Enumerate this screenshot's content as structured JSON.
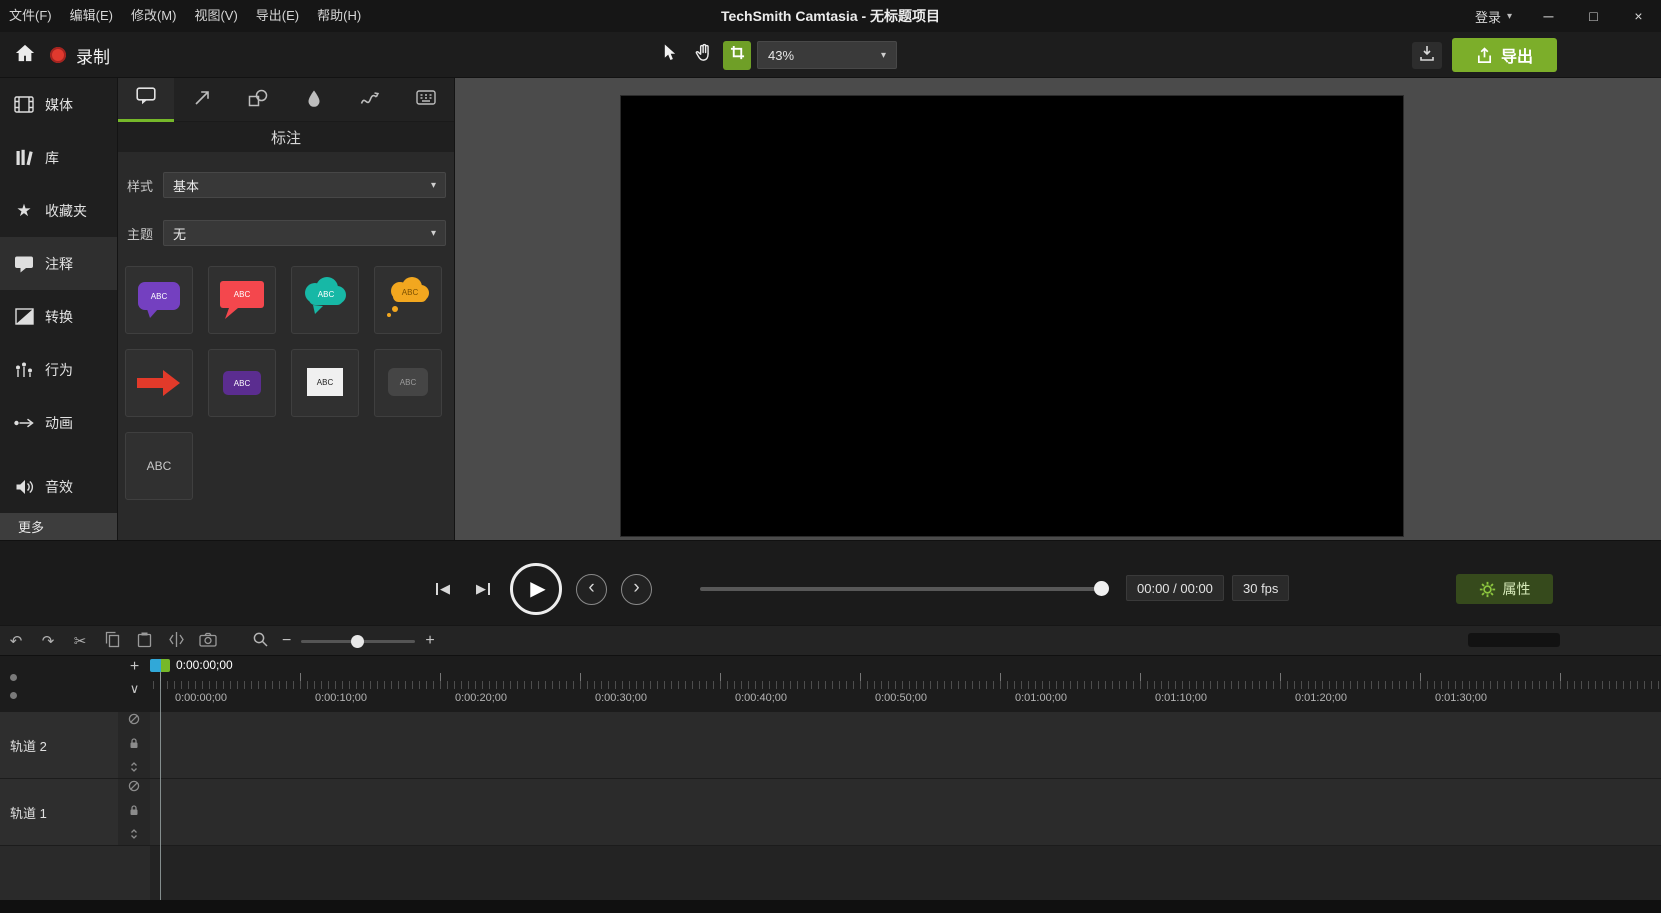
{
  "colors": {
    "accent_green": "#76b82a",
    "export_green": "#7cae2a",
    "record_red": "#e0392e",
    "crop_active_bg": "#6f9f27"
  },
  "glyphs": {
    "caret_down": "▾",
    "minimize": "─",
    "maximize": "□",
    "close": "×",
    "play": "▶",
    "step_back": "◀",
    "step_forward": "▶",
    "jump_back": "‹",
    "jump_forward": "›",
    "undo": "↶",
    "redo": "↷",
    "cut": "✂",
    "minus": "−",
    "plus": "+",
    "add_track": "+",
    "collapse_tracks": "∨",
    "star": "★"
  },
  "window": {
    "title": "TechSmith Camtasia - 无标题项目",
    "sign_in": "登录"
  },
  "menu_bar": {
    "items": [
      "文件(F)",
      "编辑(E)",
      "修改(M)",
      "视图(V)",
      "导出(E)",
      "帮助(H)"
    ]
  },
  "toolbar": {
    "record_label": "录制",
    "zoom_value": "43%",
    "export_label": "导出"
  },
  "sidebar": {
    "items": [
      {
        "label": "媒体",
        "icon": "film-icon"
      },
      {
        "label": "库",
        "icon": "library-icon"
      },
      {
        "label": "收藏夹",
        "icon": "star-icon"
      },
      {
        "label": "注释",
        "icon": "callout-icon",
        "selected": true
      },
      {
        "label": "转换",
        "icon": "transition-icon"
      },
      {
        "label": "行为",
        "icon": "behaviors-icon"
      },
      {
        "label": "动画",
        "icon": "animation-icon"
      },
      {
        "label": "音效",
        "icon": "audio-icon"
      }
    ],
    "more_label": "更多"
  },
  "panel": {
    "title": "标注",
    "style_label": "样式",
    "style_value": "基本",
    "theme_label": "主题",
    "theme_value": "无",
    "tile_text": "ABC",
    "tiles": [
      {
        "name": "rounded-callout",
        "color": "#7440c0"
      },
      {
        "name": "speech-bubble",
        "color": "#f4474d"
      },
      {
        "name": "cloud-callout",
        "color": "#17b8a6"
      },
      {
        "name": "thought-cloud",
        "color": "#f2a71f"
      },
      {
        "name": "arrow-callout",
        "color": "#e23a2a"
      },
      {
        "name": "banner-callout",
        "color": "#5b2d90"
      },
      {
        "name": "text-box",
        "color": "#f0f0f0"
      },
      {
        "name": "subtle-callout",
        "color": "#454545"
      },
      {
        "name": "plain-text",
        "color": "#c4c4c4"
      }
    ]
  },
  "playback": {
    "time_display": "00:00 / 00:00",
    "fps_display": "30 fps",
    "properties_label": "属性"
  },
  "timeline": {
    "playhead_time": "0:00:00;00",
    "ruler_labels": [
      "0:00:00;00",
      "0:00:10;00",
      "0:00:20;00",
      "0:00:30;00",
      "0:00:40;00",
      "0:00:50;00",
      "0:01:00;00",
      "0:01:10;00",
      "0:01:20;00",
      "0:01:30;00"
    ],
    "tracks": [
      {
        "label": "轨道 2"
      },
      {
        "label": "轨道 1"
      }
    ]
  }
}
